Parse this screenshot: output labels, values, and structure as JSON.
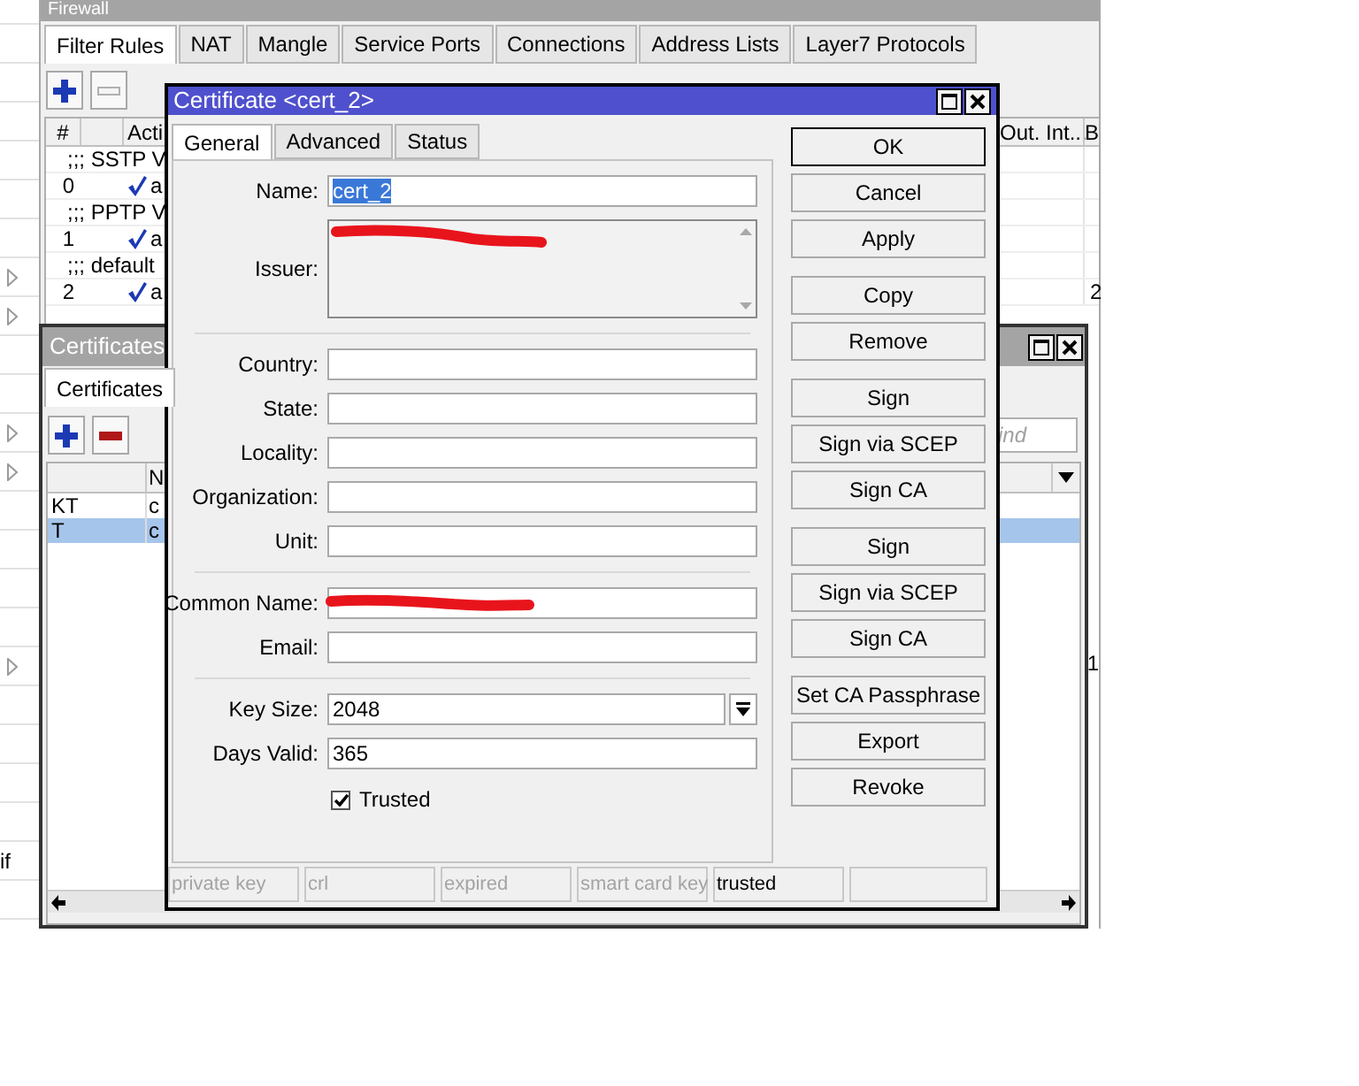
{
  "left_panel": {
    "rows": [
      {
        "marker": false
      },
      {
        "marker": false
      },
      {
        "marker": false
      },
      {
        "marker": false
      },
      {
        "marker": false
      },
      {
        "marker": false
      },
      {
        "marker": false
      },
      {
        "marker": true
      },
      {
        "marker": true
      },
      {
        "marker": false
      },
      {
        "marker": false
      },
      {
        "marker": true
      },
      {
        "marker": true
      },
      {
        "marker": false
      },
      {
        "marker": false
      },
      {
        "marker": false
      },
      {
        "marker": false
      },
      {
        "marker": true
      },
      {
        "marker": false
      },
      {
        "marker": false
      },
      {
        "marker": false
      },
      {
        "marker": false
      },
      {
        "marker": false,
        "text": "if"
      },
      {
        "marker": false
      }
    ]
  },
  "firewall": {
    "title": "Firewall",
    "tabs": [
      {
        "label": "Filter Rules",
        "selected": true
      },
      {
        "label": "NAT",
        "selected": false
      },
      {
        "label": "Mangle",
        "selected": false
      },
      {
        "label": "Service Ports",
        "selected": false
      },
      {
        "label": "Connections",
        "selected": false
      },
      {
        "label": "Address Lists",
        "selected": false
      },
      {
        "label": "Layer7 Protocols",
        "selected": false
      }
    ],
    "columns": {
      "number": "#",
      "action": "Acti",
      "out_interface": "Out. Int...",
      "bytes": "B"
    },
    "rows": [
      {
        "kind": "comment",
        "text": ";;; SSTP V"
      },
      {
        "kind": "rule",
        "number": "0",
        "action": "a"
      },
      {
        "kind": "comment",
        "text": ";;; PPTP V"
      },
      {
        "kind": "rule",
        "number": "1",
        "action": "a"
      },
      {
        "kind": "comment",
        "text": ";;; default"
      },
      {
        "kind": "rule",
        "number": "2",
        "action": "a",
        "bytes": "2"
      }
    ],
    "bytes_fragment": "1"
  },
  "certificates": {
    "title": "Certificates",
    "tabs": [
      {
        "label": "Certificates",
        "selected": true
      }
    ],
    "search": {
      "placeholder": "ind"
    },
    "columns": [
      "",
      "N"
    ],
    "rows": [
      {
        "cells": [
          "KT",
          "c"
        ],
        "selected": false
      },
      {
        "cells": [
          "T",
          "c"
        ],
        "selected": true
      }
    ]
  },
  "dialog": {
    "title": "Certificate <cert_2>",
    "tabs": [
      {
        "label": "General",
        "selected": true
      },
      {
        "label": "Advanced",
        "selected": false
      },
      {
        "label": "Status",
        "selected": false
      }
    ],
    "field_groups": [
      [
        {
          "kind": "text",
          "label": "Name:",
          "value": "cert_2",
          "value_selected": true
        },
        {
          "kind": "multiline",
          "label": "Issuer:",
          "redacted": true
        }
      ],
      [
        {
          "kind": "text",
          "label": "Country:"
        },
        {
          "kind": "text",
          "label": "State:"
        },
        {
          "kind": "text",
          "label": "Locality:"
        },
        {
          "kind": "text",
          "label": "Organization:"
        },
        {
          "kind": "text",
          "label": "Unit:"
        }
      ],
      [
        {
          "kind": "text",
          "label": "Common Name:",
          "redacted": true
        },
        {
          "kind": "text",
          "label": "Email:"
        }
      ],
      [
        {
          "kind": "dropdown",
          "label": "Key Size:",
          "value": "2048"
        },
        {
          "kind": "text",
          "label": "Days Valid:",
          "value": "365"
        },
        {
          "kind": "checkbox",
          "label": "Trusted",
          "checked": true
        }
      ]
    ],
    "button_groups": [
      [
        {
          "label": "OK",
          "default": true
        },
        {
          "label": "Cancel",
          "default": false
        },
        {
          "label": "Apply",
          "default": false
        }
      ],
      [
        {
          "label": "Copy",
          "default": false
        },
        {
          "label": "Remove",
          "default": false
        }
      ],
      [
        {
          "label": "Sign",
          "default": false
        },
        {
          "label": "Sign via SCEP",
          "default": false
        },
        {
          "label": "Sign CA",
          "default": false
        }
      ],
      [
        {
          "label": "Sign",
          "default": false
        },
        {
          "label": "Sign via SCEP",
          "default": false
        },
        {
          "label": "Sign CA",
          "default": false
        }
      ],
      [
        {
          "label": "Set CA Passphrase",
          "default": false
        },
        {
          "label": "Export",
          "default": false
        },
        {
          "label": "Revoke",
          "default": false
        }
      ]
    ],
    "status_flags": [
      {
        "label": "private key",
        "active": false
      },
      {
        "label": "crl",
        "active": false
      },
      {
        "label": "expired",
        "active": false
      },
      {
        "label": "smart card key",
        "active": false
      },
      {
        "label": "trusted",
        "active": true
      }
    ]
  }
}
